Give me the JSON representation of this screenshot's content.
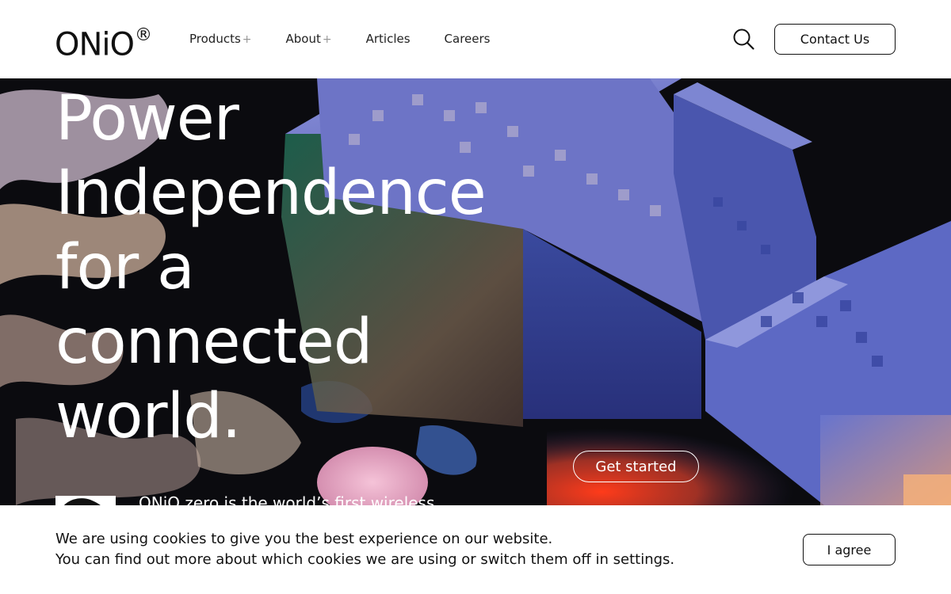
{
  "brand": {
    "name": "ONiO",
    "mark": "®"
  },
  "nav": {
    "items": [
      {
        "label": "Products",
        "suffix": "+"
      },
      {
        "label": "About",
        "suffix": "+"
      },
      {
        "label": "Articles",
        "suffix": ""
      },
      {
        "label": "Careers",
        "suffix": ""
      }
    ],
    "search_icon": "search-icon",
    "contact_label": "Contact Us"
  },
  "hero": {
    "headline_lines": [
      "Power",
      "Independence",
      "for a",
      "connected",
      "world."
    ],
    "cta_label": "Get started",
    "product_teaser": "ONiO zero is the world’s first wireless"
  },
  "cookie": {
    "line1": "We are using cookies to give you the best experience on our website.",
    "line2": "You can find out more about which cookies we are using or switch them off in settings.",
    "agree_label": "I agree"
  },
  "colors": {
    "hero_block_blue": "#5a63b8",
    "hero_accent_red": "#e8402a",
    "header_bg": "#ffffff"
  }
}
